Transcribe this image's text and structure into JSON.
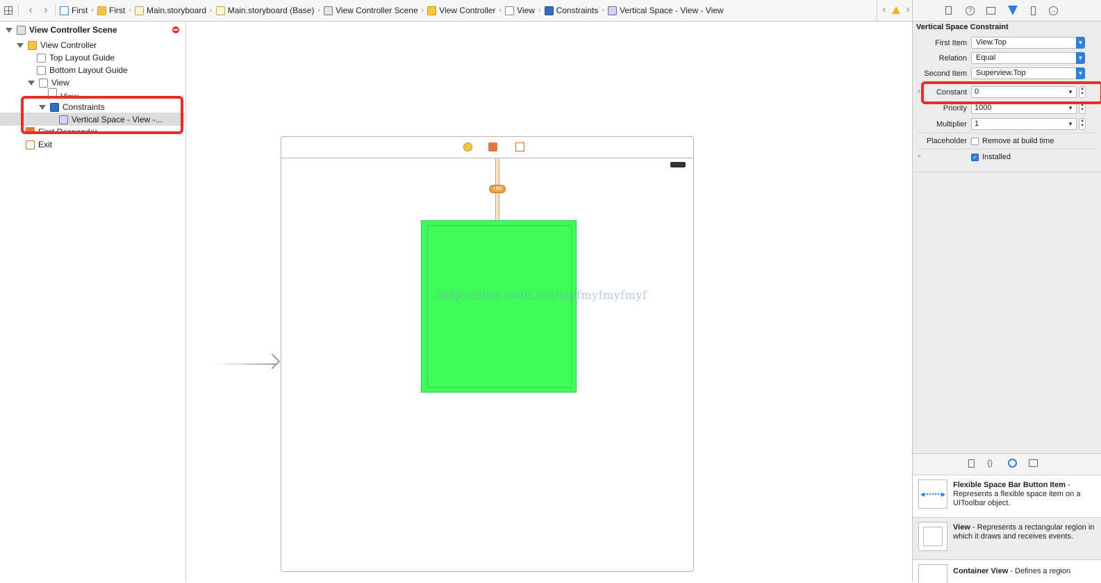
{
  "jumpbar": {
    "crumbs": [
      {
        "label": "First",
        "icon": "storyboard-project-icon"
      },
      {
        "label": "First",
        "icon": "folder-icon"
      },
      {
        "label": "Main.storyboard",
        "icon": "storyboard-file-icon"
      },
      {
        "label": "Main.storyboard (Base)",
        "icon": "storyboard-file-icon"
      },
      {
        "label": "View Controller Scene",
        "icon": "scene-icon"
      },
      {
        "label": "View Controller",
        "icon": "view-controller-icon"
      },
      {
        "label": "View",
        "icon": "view-icon"
      },
      {
        "label": "Constraints",
        "icon": "constraints-icon"
      },
      {
        "label": "Vertical Space - View - View",
        "icon": "vertical-space-icon"
      }
    ]
  },
  "outline": {
    "scene_title": "View Controller Scene",
    "view_controller": "View Controller",
    "top_layout_guide": "Top Layout Guide",
    "bottom_layout_guide": "Bottom Layout Guide",
    "view": "View",
    "subview": "View",
    "constraints": "Constraints",
    "vertical_space": "Vertical Space - View -...",
    "first_responder": "First Responder",
    "exit": "Exit"
  },
  "canvas": {
    "constraint_badge": "+90",
    "watermark": "http://blog.csdn.net/myfmyfmyfmyf",
    "subview_color": "#3ffb5a"
  },
  "inspector": {
    "tabs": [
      "file-inspector-icon",
      "quick-help-icon",
      "identity-inspector-icon",
      "attributes-inspector-icon",
      "size-inspector-icon",
      "connections-inspector-icon"
    ],
    "section_title": "Vertical Space Constraint",
    "first_item_label": "First Item",
    "first_item_value": "View.Top",
    "relation_label": "Relation",
    "relation_value": "Equal",
    "second_item_label": "Second Item",
    "second_item_value": "Superview.Top",
    "constant_label": "Constant",
    "constant_value": "0",
    "priority_label": "Priority",
    "priority_value": "1000",
    "multiplier_label": "Multiplier",
    "multiplier_value": "1",
    "placeholder_label": "Placeholder",
    "placeholder_checkbox": "Remove at build time",
    "installed_checkbox": "Installed",
    "installed_checked": true
  },
  "library": {
    "items": [
      {
        "title": "Flexible Space Bar Button Item",
        "desc": " - Represents a flexible space item on a UIToolbar object."
      },
      {
        "title": "View",
        "desc": " - Represents a rectangular region in which it draws and receives events."
      },
      {
        "title": "Container View",
        "desc": " - Defines a region"
      }
    ]
  },
  "colors": {
    "highlight": "#e5302a",
    "accent_blue": "#2f7ee6",
    "green": "#3ffb5a"
  }
}
